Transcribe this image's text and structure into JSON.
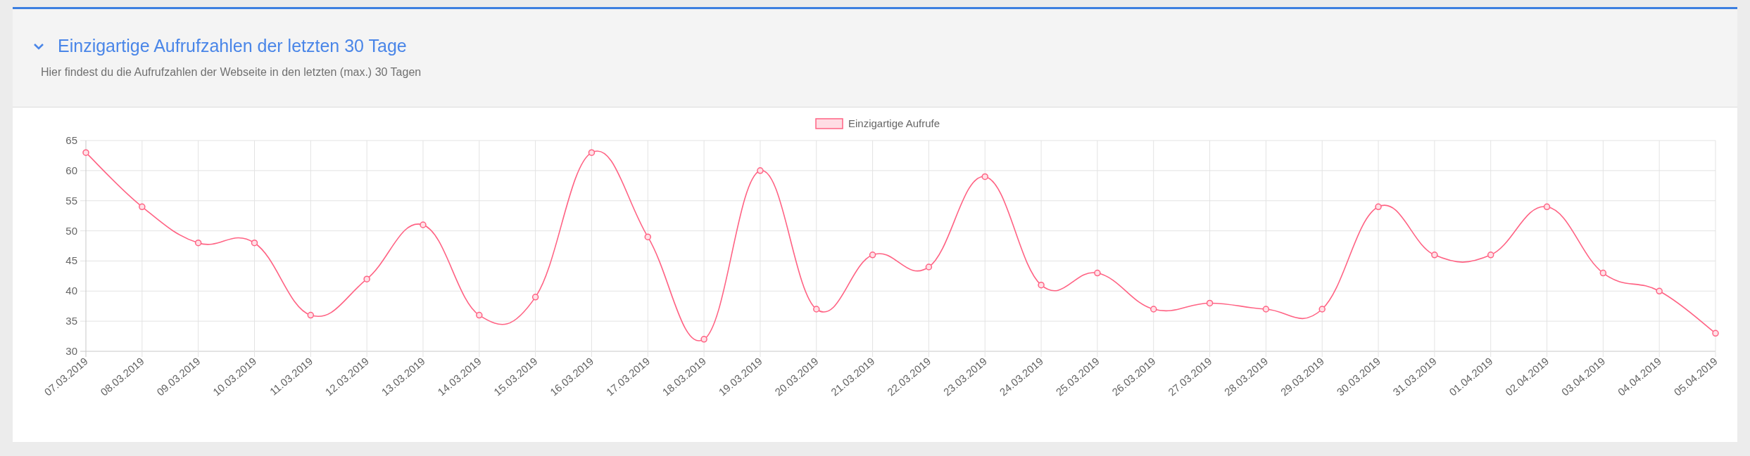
{
  "panel": {
    "title": "Einzigartige Aufrufzahlen der letzten 30 Tage",
    "subtitle": "Hier findest du die Aufrufzahlen der Webseite in den letzten (max.) 30 Tagen",
    "expanded": true,
    "chart_data": {
      "type": "line",
      "categories": [
        "07.03.2019",
        "08.03.2019",
        "09.03.2019",
        "10.03.2019",
        "11.03.2019",
        "12.03.2019",
        "13.03.2019",
        "14.03.2019",
        "15.03.2019",
        "16.03.2019",
        "17.03.2019",
        "18.03.2019",
        "19.03.2019",
        "20.03.2019",
        "21.03.2019",
        "22.03.2019",
        "23.03.2019",
        "24.03.2019",
        "25.03.2019",
        "26.03.2019",
        "27.03.2019",
        "28.03.2019",
        "29.03.2019",
        "30.03.2019",
        "31.03.2019",
        "01.04.2019",
        "02.04.2019",
        "03.04.2019",
        "04.04.2019",
        "05.04.2019"
      ],
      "grid": true,
      "series": [
        {
          "name": "Einzigartige Aufrufe",
          "color": "#ff6384",
          "marker": "circle",
          "values": [
            63,
            54,
            48,
            48,
            36,
            42,
            51,
            36,
            39,
            63,
            49,
            32,
            60,
            37,
            46,
            44,
            59,
            41,
            43,
            37,
            38,
            37,
            37,
            54,
            46,
            46,
            54,
            43,
            40,
            33
          ]
        }
      ],
      "ylim": [
        30,
        65
      ],
      "yticks": [
        30,
        35,
        40,
        45,
        50,
        55,
        60,
        65
      ]
    }
  }
}
